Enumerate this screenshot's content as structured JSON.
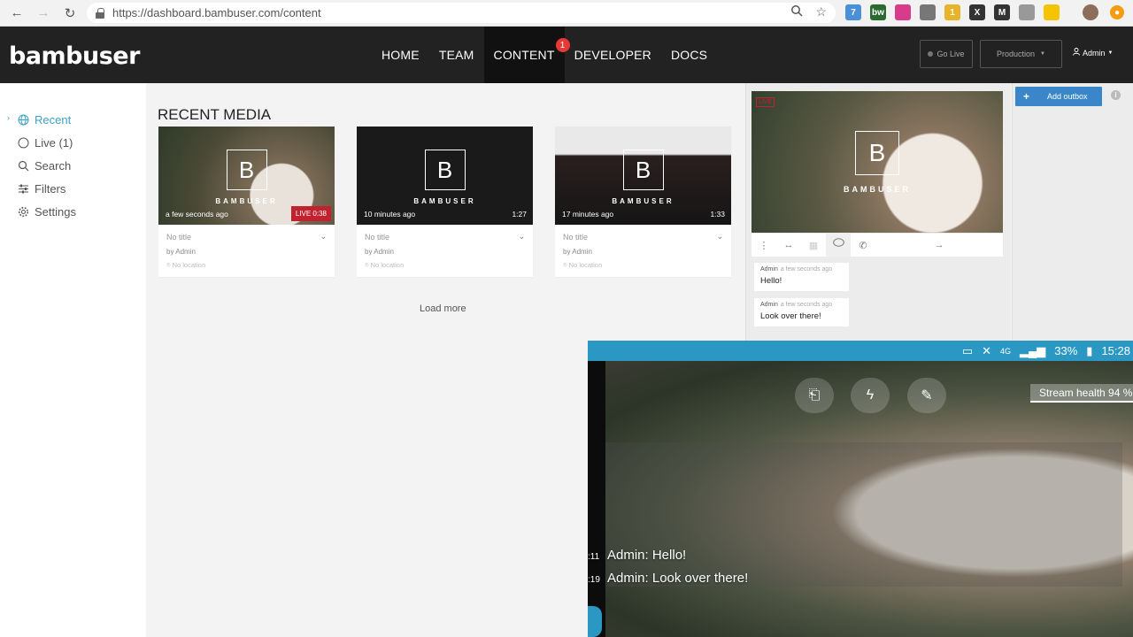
{
  "browser": {
    "url": "https://dashboard.bambuser.com/content",
    "extensions": [
      {
        "icon": "extension-badge-icon",
        "label": "7",
        "color": "#4a90d9"
      },
      {
        "icon": "bw-extension-icon",
        "label": "bw",
        "color": "#2c6b2f"
      },
      {
        "icon": "color-wheel-icon",
        "label": "",
        "color": "#d83b8a"
      },
      {
        "icon": "cast-icon",
        "label": "",
        "color": "#777777"
      },
      {
        "icon": "extension-badge-icon",
        "label": "1",
        "color": "#e8b22a"
      },
      {
        "icon": "x-extension-icon",
        "label": "X",
        "color": "#333333"
      },
      {
        "icon": "m-extension-icon",
        "label": "M",
        "color": "#333333"
      },
      {
        "icon": "circle-extension-icon",
        "label": "",
        "color": "#999999"
      },
      {
        "icon": "honey-extension-icon",
        "label": "",
        "color": "#f5c400"
      }
    ]
  },
  "header": {
    "logo": "bambuser",
    "nav": [
      {
        "label": "HOME",
        "active": false
      },
      {
        "label": "TEAM",
        "active": false
      },
      {
        "label": "CONTENT",
        "active": true,
        "badge": "1"
      },
      {
        "label": "DEVELOPER",
        "active": false
      },
      {
        "label": "DOCS",
        "active": false
      }
    ],
    "go_live": "Go Live",
    "environment": "Production",
    "user": "Admin"
  },
  "sidebar": {
    "items": [
      {
        "label": "Recent",
        "icon": "globe-icon",
        "active": true
      },
      {
        "label": "Live (1)",
        "icon": "circle-icon",
        "active": false
      },
      {
        "label": "Search",
        "icon": "search-icon",
        "active": false
      },
      {
        "label": "Filters",
        "icon": "sliders-icon",
        "active": false
      },
      {
        "label": "Settings",
        "icon": "gear-icon",
        "active": false
      }
    ]
  },
  "main": {
    "title": "RECENT MEDIA",
    "load_more": "Load more",
    "brand_mark": "B",
    "brand_name": "BAMBUSER",
    "cards": [
      {
        "ago": "a few seconds ago",
        "duration": "LIVE 0:38",
        "live": true,
        "title": "No title",
        "by": "by Admin",
        "location": "No location"
      },
      {
        "ago": "10 minutes ago",
        "duration": "1:27",
        "live": false,
        "title": "No title",
        "by": "by Admin",
        "location": "No location"
      },
      {
        "ago": "17 minutes ago",
        "duration": "1:33",
        "live": false,
        "title": "No title",
        "by": "by Admin",
        "location": "No location"
      }
    ]
  },
  "player": {
    "live_label": "LIVE",
    "chat": [
      {
        "user": "Admin",
        "time": "a few seconds ago",
        "text": "Hello!"
      },
      {
        "user": "Admin",
        "time": "a few seconds ago",
        "text": "Look over there!"
      }
    ]
  },
  "outbox": {
    "add_label": "Add outbox"
  },
  "phone": {
    "status": {
      "battery": "33%",
      "time": "15:28",
      "network": "4G"
    },
    "stream_health": "Stream health 94 %",
    "chat": [
      {
        "time": ":11",
        "text": "Admin: Hello!"
      },
      {
        "time": ":19",
        "text": "Admin: Look over there!"
      }
    ]
  }
}
